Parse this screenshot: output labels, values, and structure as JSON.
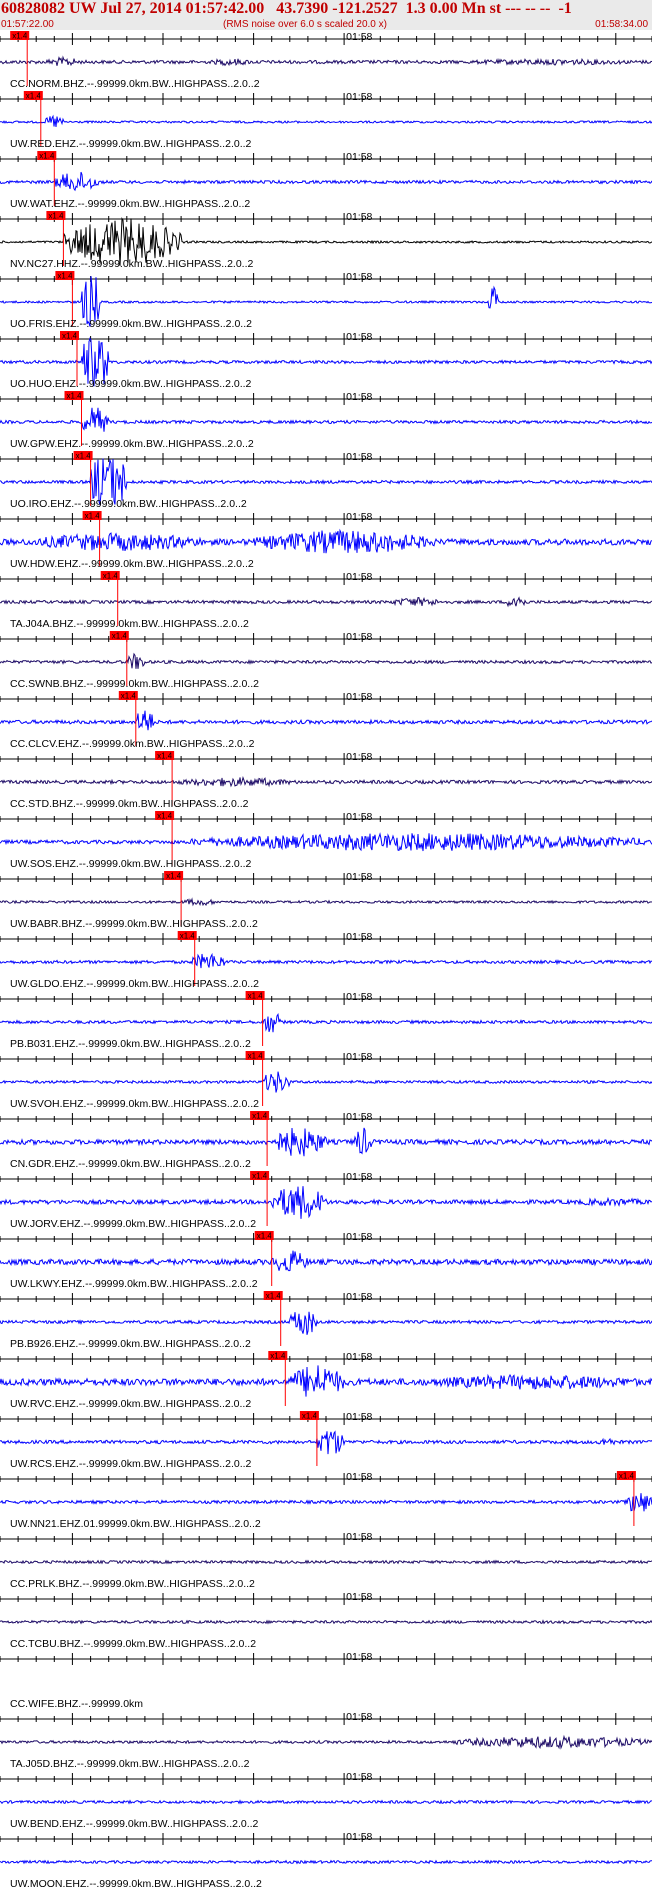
{
  "header": {
    "title": "60828082 UW Jul 27, 2014 01:57:42.00   43.7390 -121.2527  1.3 0.00 Mn st --- -- --  -1",
    "start_time": "01:57:22.00",
    "note": "(RMS noise over 6.0 s scaled 20.0 x)",
    "end_time": "01:58:34.00"
  },
  "pick_label": "x1.4",
  "minute_label": "01:58",
  "colors": {
    "header_bg": "#eaeaea",
    "header_text": "#c00000",
    "blue": "#0000ff",
    "navy": "#1c0a66",
    "black": "#000000",
    "pick": "#ff0000"
  },
  "chart_data": {
    "type": "line",
    "title": "60828082 UW Jul 27, 2014 01:57:42.00",
    "x_range": [
      "01:57:22.00",
      "01:58:34.00"
    ],
    "x_tick_labels": [
      "01:58"
    ],
    "series": [
      {
        "name": "CC.NORM.BHZ.--.99999.0km.BW..HIGHPASS..2.0..2",
        "color": "navy",
        "pick": "01:57:25",
        "amplitude": 0.55,
        "bursts": [
          [
            "01:57:27",
            "01:57:31",
            1.6
          ],
          [
            "01:57:45",
            "01:57:50",
            1.2
          ],
          [
            "01:58:12",
            "01:58:34",
            1.0
          ]
        ]
      },
      {
        "name": "UW.RED.EHZ.--.99999.0km.BW..HIGHPASS..2.0..2",
        "color": "blue",
        "pick": "01:57:26.5",
        "amplitude": 0.35,
        "bursts": [
          [
            "01:57:27",
            "01:57:29",
            2.5
          ]
        ]
      },
      {
        "name": "UW.WAT.EHZ.--.99999.0km.BW..HIGHPASS..2.0..2",
        "color": "blue",
        "pick": "01:57:28",
        "amplitude": 0.5,
        "bursts": [
          [
            "01:57:28",
            "01:57:33",
            3.5
          ]
        ]
      },
      {
        "name": "NV.NC27.HHZ.--.99999.0km.BW..HIGHPASS..2.0..2",
        "color": "black",
        "pick": "01:57:29",
        "amplitude": 0.35,
        "bursts": [
          [
            "01:57:29",
            "01:57:42",
            8.0
          ]
        ]
      },
      {
        "name": "UO.FRIS.EHZ.--.99999.0km.BW..HIGHPASS..2.0..2",
        "color": "blue",
        "pick": "01:57:30",
        "amplitude": 0.35,
        "bursts": [
          [
            "01:57:31",
            "01:57:33",
            12.0
          ],
          [
            "01:58:16",
            "01:58:17",
            6.0
          ]
        ]
      },
      {
        "name": "UO.HUO.EHZ.--.99999.0km.BW..HIGHPASS..2.0..2",
        "color": "blue",
        "pick": "01:57:30.5",
        "amplitude": 0.5,
        "bursts": [
          [
            "01:57:31",
            "01:57:34",
            12.0
          ]
        ]
      },
      {
        "name": "UW.GPW.EHZ.--.99999.0km.BW..HIGHPASS..2.0..2",
        "color": "blue",
        "pick": "01:57:31",
        "amplitude": 0.5,
        "bursts": [
          [
            "01:57:31",
            "01:57:34",
            5.0
          ]
        ]
      },
      {
        "name": "UO.IRO.EHZ.--.99999.0km.BW..HIGHPASS..2.0..2",
        "color": "blue",
        "pick": "01:57:32",
        "amplitude": 0.5,
        "bursts": [
          [
            "01:57:32",
            "01:57:36",
            12.0
          ]
        ]
      },
      {
        "name": "UW.HDW.EHZ.--.99999.0km.BW..HIGHPASS..2.0..2",
        "color": "blue",
        "pick": "01:57:33",
        "amplitude": 1.0,
        "bursts": [
          [
            "01:57:25",
            "01:57:45",
            3.0
          ],
          [
            "01:57:50",
            "01:58:10",
            4.0
          ]
        ]
      },
      {
        "name": "TA.J04A.BHZ.--.99999.0km.BW..HIGHPASS..2.0..2",
        "color": "navy",
        "pick": "01:57:35",
        "amplitude": 0.5,
        "bursts": [
          [
            "01:58:05",
            "01:58:11",
            1.5
          ],
          [
            "01:58:18",
            "01:58:20",
            3.0
          ]
        ]
      },
      {
        "name": "CC.SWNB.BHZ.--.99999.0km.BW..HIGHPASS..2.0..2",
        "color": "navy",
        "pick": "01:57:36",
        "amplitude": 0.5,
        "bursts": [
          [
            "01:57:36",
            "01:57:38",
            3.0
          ]
        ]
      },
      {
        "name": "CC.CLCV.EHZ.--.99999.0km.BW..HIGHPASS..2.0..2",
        "color": "blue",
        "pick": "01:57:37",
        "amplitude": 0.6,
        "bursts": [
          [
            "01:57:37",
            "01:57:39",
            5.0
          ]
        ]
      },
      {
        "name": "CC.STD.BHZ.--.99999.0km.BW..HIGHPASS..2.0..2",
        "color": "navy",
        "pick": "01:57:41",
        "amplitude": 0.55,
        "bursts": [
          [
            "01:57:41",
            "01:57:55",
            1.5
          ]
        ]
      },
      {
        "name": "UW.SOS.EHZ.--.99999.0km.BW..HIGHPASS..2.0..2",
        "color": "blue",
        "pick": "01:57:41",
        "amplitude": 0.6,
        "bursts": [
          [
            "01:57:43",
            "01:58:34",
            3.0
          ]
        ]
      },
      {
        "name": "UW.BABR.BHZ.--.99999.0km.BW..HIGHPASS..2.0..2",
        "color": "navy",
        "pick": "01:57:42",
        "amplitude": 0.4,
        "bursts": [
          [
            "01:57:42",
            "01:57:46",
            1.2
          ]
        ]
      },
      {
        "name": "UW.GLDO.EHZ.--.99999.0km.BW..HIGHPASS..2.0..2",
        "color": "blue",
        "pick": "01:57:43.5",
        "amplitude": 0.5,
        "bursts": [
          [
            "01:57:43",
            "01:57:47",
            3.0
          ]
        ]
      },
      {
        "name": "PB.B031.EHZ.--.99999.0km.BW..HIGHPASS..2.0..2",
        "color": "blue",
        "pick": "01:57:51",
        "amplitude": 0.5,
        "bursts": [
          [
            "01:57:51",
            "01:57:53",
            4.0
          ]
        ]
      },
      {
        "name": "UW.SVOH.EHZ.--.99999.0km.BW..HIGHPASS..2.0..2",
        "color": "blue",
        "pick": "01:57:51",
        "amplitude": 0.45,
        "bursts": [
          [
            "01:57:51",
            "01:57:54",
            4.0
          ]
        ]
      },
      {
        "name": "CN.GDR.EHZ.--.99999.0km.BW..HIGHPASS..2.0..2",
        "color": "blue",
        "pick": "01:57:51.5",
        "amplitude": 0.8,
        "bursts": [
          [
            "01:57:52",
            "01:57:58",
            5.0
          ],
          [
            "01:58:01",
            "01:58:03",
            5.0
          ]
        ]
      },
      {
        "name": "UW.JORV.EHZ.--.99999.0km.BW..HIGHPASS..2.0..2",
        "color": "blue",
        "pick": "01:57:51.5",
        "amplitude": 0.7,
        "bursts": [
          [
            "01:57:52",
            "01:57:58",
            6.0
          ],
          [
            "01:58:25",
            "01:58:34",
            1.3
          ]
        ]
      },
      {
        "name": "UW.LKWY.EHZ.--.99999.0km.BW..HIGHPASS..2.0..2",
        "color": "blue",
        "pick": "01:57:52",
        "amplitude": 0.9,
        "bursts": [
          [
            "01:57:52",
            "01:57:56",
            4.0
          ]
        ]
      },
      {
        "name": "PB.B926.EHZ.--.99999.0km.BW..HIGHPASS..2.0..2",
        "color": "blue",
        "pick": "01:57:53",
        "amplitude": 0.5,
        "bursts": [
          [
            "01:57:54",
            "01:57:57",
            5.0
          ]
        ]
      },
      {
        "name": "UW.RVC.EHZ.--.99999.0km.BW..HIGHPASS..2.0..2",
        "color": "blue",
        "pick": "01:57:53.5",
        "amplitude": 1.1,
        "bursts": [
          [
            "01:57:54",
            "01:58:00",
            6.0
          ],
          [
            "01:58:08",
            "01:58:34",
            2.5
          ]
        ]
      },
      {
        "name": "UW.RCS.EHZ.--.99999.0km.BW..HIGHPASS..2.0..2",
        "color": "blue",
        "pick": "01:57:57",
        "amplitude": 0.55,
        "bursts": [
          [
            "01:57:57",
            "01:58:00",
            5.0
          ],
          [
            "01:58:28",
            "01:58:30",
            1.6
          ]
        ]
      },
      {
        "name": "UW.NN21.EHZ.01.99999.0km.BW..HIGHPASS..2.0..2",
        "color": "blue",
        "pick": "01:58:32",
        "amplitude": 0.5,
        "bursts": [
          [
            "01:58:31",
            "01:58:34",
            4.0
          ]
        ]
      },
      {
        "name": "CC.PRLK.BHZ.--.99999.0km.BW..HIGHPASS..2.0..2",
        "color": "navy",
        "amplitude": 0.45,
        "bursts": []
      },
      {
        "name": "CC.TCBU.BHZ.--.99999.0km.BW..HIGHPASS..2.0..2",
        "color": "navy",
        "amplitude": 0.45,
        "bursts": []
      },
      {
        "name": "CC.WIFE.BHZ.--.99999.0km",
        "color": "navy",
        "amplitude": 0.0,
        "bursts": []
      },
      {
        "name": "TA.J05D.BHZ.--.99999.0km.BW..HIGHPASS..2.0..2",
        "color": "navy",
        "amplitude": 0.45,
        "bursts": [
          [
            "01:58:12",
            "01:58:34",
            2.0
          ]
        ]
      },
      {
        "name": "UW.BEND.EHZ.--.99999.0km.BW..HIGHPASS..2.0..2",
        "color": "blue",
        "amplitude": 0.45,
        "bursts": []
      },
      {
        "name": "UW.MOON.EHZ.--.99999.0km.BW..HIGHPASS..2.0..2",
        "color": "blue",
        "amplitude": 0.45,
        "bursts": []
      }
    ]
  }
}
